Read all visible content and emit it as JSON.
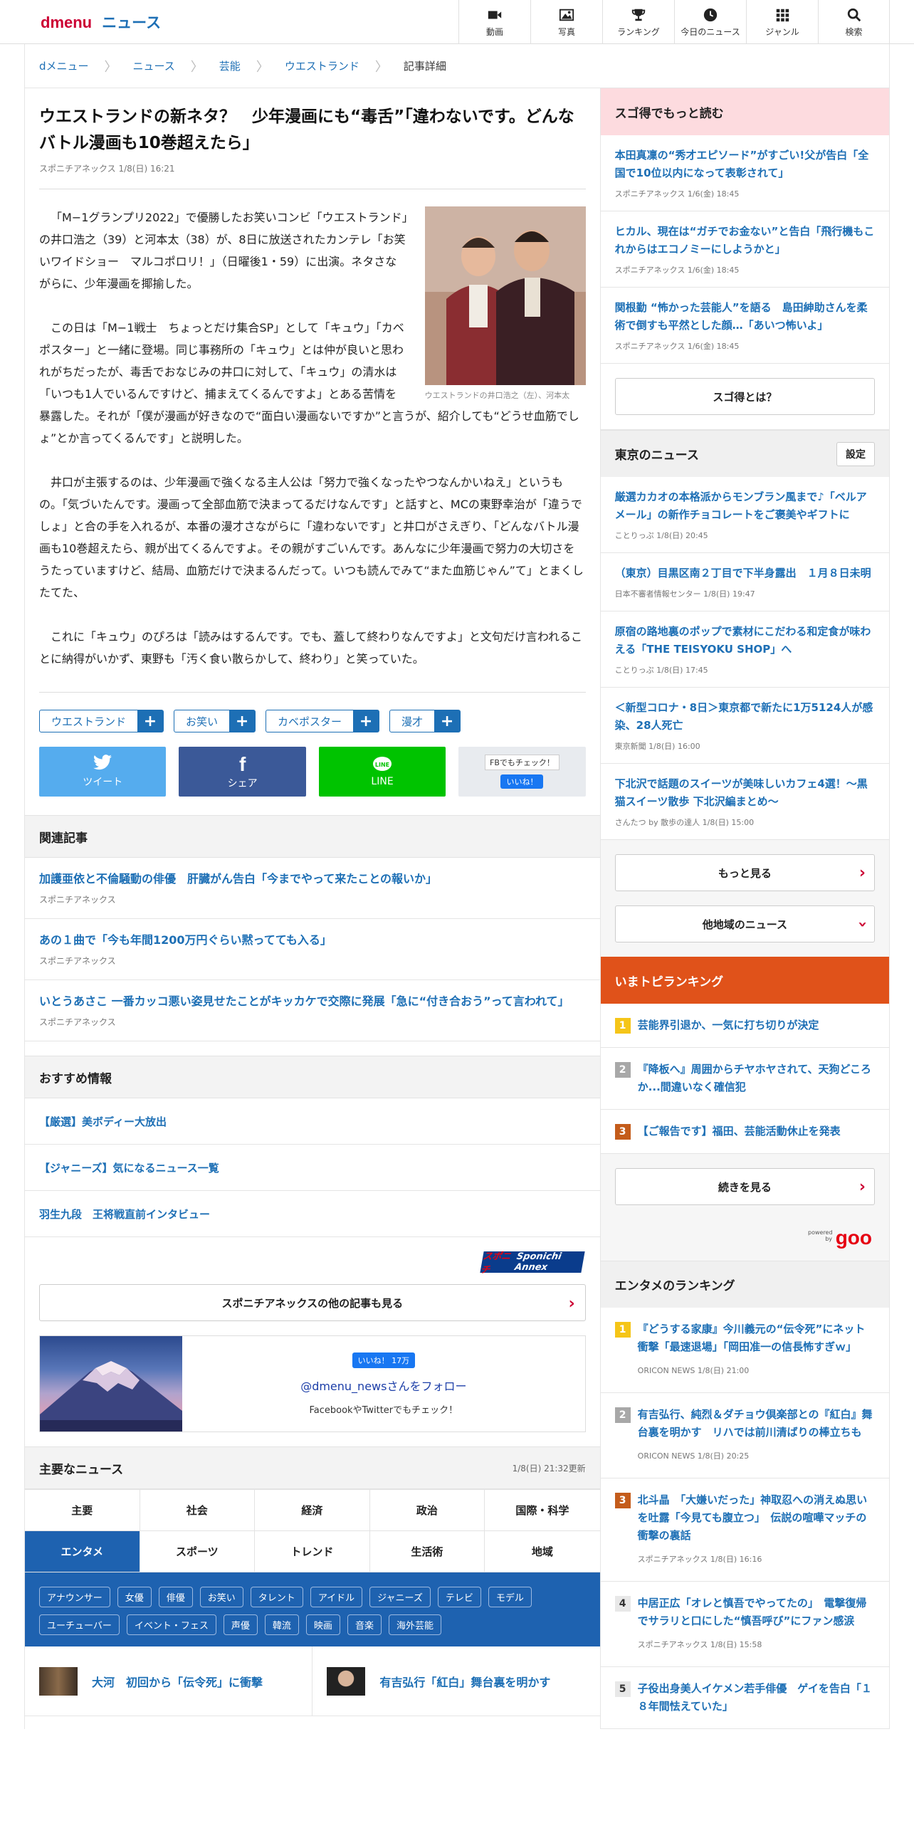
{
  "header": {
    "logo": "dmenu",
    "section": "ニュース",
    "nav": [
      {
        "label": "動画",
        "icon": "video-icon"
      },
      {
        "label": "写真",
        "icon": "photo-icon"
      },
      {
        "label": "ランキング",
        "icon": "trophy-icon"
      },
      {
        "label": "今日のニュース",
        "icon": "clock-icon"
      },
      {
        "label": "ジャンル",
        "icon": "grid-icon"
      },
      {
        "label": "検索",
        "icon": "search-icon"
      }
    ]
  },
  "breadcrumb": [
    "dメニュー",
    "ニュース",
    "芸能",
    "ウエストランド",
    "記事詳細"
  ],
  "article": {
    "title": "ウエストランドの新ネタ？　少年漫画にも“毒舌”「違わないです。どんなバトル漫画も10巻超えたら」",
    "meta": "スポニチアネックス 1/8(日) 16:21",
    "photo_caption": "ウエストランドの井口浩之（左）、河本太",
    "paragraphs": [
      "「M−1グランプリ2022」で優勝したお笑いコンビ「ウエストランド」の井口浩之（39）と河本太（38）が、8日に放送されたカンテレ「お笑いワイドショー　マルコポロリ！」（日曜後1・59）に出演。ネタさながらに、少年漫画を揶揄した。",
      "この日は「M−1戦士　ちょっとだけ集合SP」として「キュウ」「カベポスター」と一緒に登場。同じ事務所の「キュウ」とは仲が良いと思われがちだったが、毒舌でおなじみの井口に対して、「キュウ」の清水は「いつも1人でいるんですけど、捕まえてくるんですよ」とある苦情を暴露した。それが「僕が漫画が好きなので“面白い漫画ないですか”と言うが、紹介しても“どうせ血筋でしょ”とか言ってくるんです」と説明した。",
      "井口が主張するのは、少年漫画で強くなる主人公は「努力で強くなったやつなんかいねえ」というもの。「気づいたんです。漫画って全部血筋で決まってるだけなんです」と話すと、MCの東野幸治が「違うでしょ」と合の手を入れるが、本番の漫才さながらに「違わないです」と井口がさえぎり、「どんなバトル漫画も10巻超えたら、親が出てくるんですよ。その親がすごいんです。あんなに少年漫画で努力の大切さをうたっていますけど、結局、血筋だけで決まるんだって。いつも読んでみて“また血筋じゃん”て」とまくしたてた、",
      "これに「キュウ」のぴろは「読みはするんです。でも、蓋して終わりなんですよ」と文句だけ言われることに納得がいかず、東野も「汚く食い散らかして、終わり」と笑っていた。"
    ],
    "tags": [
      "ウエストランド",
      "お笑い",
      "カベポスター",
      "漫才"
    ],
    "share": {
      "tweet": "ツイート",
      "facebook": "シェア",
      "line": "LINE",
      "fb_check": "FBでもチェック！",
      "like": "いいね！"
    }
  },
  "related": {
    "heading": "関連記事",
    "items": [
      {
        "title": "加護亜依と不倫騒動の俳優　肝臓がん告白「今までやって来たことの報いか」",
        "source": "スポニチアネックス"
      },
      {
        "title": "あの１曲で「今も年間1200万円ぐらい黙ってても入る」",
        "source": "スポニチアネックス"
      },
      {
        "title": "いとうあさこ 一番カッコ悪い姿見せたことがキッカケで交際に発展「急に“付き合おう”って言われて」",
        "source": "スポニチアネックス"
      }
    ]
  },
  "recommend": {
    "heading": "おすすめ情報",
    "items": [
      "【厳選】美ボディー大放出",
      "【ジャニーズ】気になるニュース一覧",
      "羽生九段　王将戦直前インタビュー"
    ]
  },
  "sponichi": {
    "logo_a": "スポニチ",
    "logo_b": "Sponichi Annex",
    "more": "スポニチアネックスの他の記事も見る"
  },
  "follow": {
    "like": "いいね！ 17万",
    "handle": "@dmenu_newsさんをフォロー",
    "sub": "FacebookやTwitterでもチェック！"
  },
  "major": {
    "heading": "主要なニュース",
    "updated": "1/8(日) 21:32更新",
    "cats": [
      "主要",
      "社会",
      "経済",
      "政治",
      "国際・科学",
      "エンタメ",
      "スポーツ",
      "トレンド",
      "生活術",
      "地域"
    ],
    "subtags": [
      "アナウンサー",
      "女優",
      "俳優",
      "お笑い",
      "タレント",
      "アイドル",
      "ジャニーズ",
      "テレビ",
      "モデル",
      "ユーチューバー",
      "イベント・フェス",
      "声優",
      "韓流",
      "映画",
      "音楽",
      "海外芸能"
    ],
    "top": [
      "大河　初回から「伝令死」に衝撃",
      "有吉弘行「紅白」舞台裏を明かす"
    ]
  },
  "sidebar": {
    "sugotoku": {
      "heading": "スゴ得でもっと読む",
      "items": [
        {
          "title": "本田真凜の“秀才エピソード”がすごい!父が告白「全国で10位以内になって表彰されて」",
          "meta": "スポニチアネックス 1/6(金) 18:45"
        },
        {
          "title": "ヒカル、現在は“ガチでお金ない”と告白「飛行機もこれからはエコノミーにしようかと」",
          "meta": "スポニチアネックス 1/6(金) 18:45"
        },
        {
          "title": "関根勤 “怖かった芸能人”を語る　島田紳助さんを柔術で倒すも平然とした顔…「あいつ怖いよ」",
          "meta": "スポニチアネックス 1/6(金) 18:45"
        }
      ],
      "button": "スゴ得とは？"
    },
    "tokyo": {
      "heading": "東京のニュース",
      "setting": "設定",
      "items": [
        {
          "title": "厳選カカオの本格派からモンブラン風まで♪「ベルアメール」の新作チョコレートをご褒美やギフトに",
          "meta": "ことりっぷ 1/8(日) 20:45"
        },
        {
          "title": "（東京）目黒区南２丁目で下半身露出　１月８日未明",
          "meta": "日本不審者情報センター 1/8(日) 19:47"
        },
        {
          "title": "原宿の路地裏のポップで素材にこだわる和定食が味わえる「THE TEISYOKU SHOP」へ",
          "meta": "ことりっぷ 1/8(日) 17:45"
        },
        {
          "title": "＜新型コロナ・8日＞東京都で新たに1万5124人が感染、28人死亡",
          "meta": "東京新聞 1/8(日) 16:00"
        },
        {
          "title": "下北沢で話題のスイーツが美味しいカフェ4選！〜黒猫スイーツ散歩 下北沢編まとめ〜",
          "meta": "さんたつ by 散歩の達人 1/8(日) 15:00"
        }
      ],
      "more": "もっと見る",
      "other": "他地域のニュース"
    },
    "topics": {
      "heading": "いまトピランキング",
      "items": [
        {
          "n": "1",
          "title": "芸能界引退か、一気に打ち切りが決定"
        },
        {
          "n": "2",
          "title": "『降板へ』周囲からチヤホヤされて、天狗どころか...間違いなく確信犯"
        },
        {
          "n": "3",
          "title": "【ご報告です】福田、芸能活動休止を発表"
        }
      ],
      "more": "続きを見る",
      "powered": "powered by",
      "goo": "goo"
    },
    "enta": {
      "heading": "エンタメのランキング",
      "items": [
        {
          "n": "1",
          "title": "『どうする家康』今川義元の“伝令死”にネット衝撃「最速退場」「岡田准一の信長怖すぎｗ」",
          "meta": "ORICON NEWS 1/8(日) 21:00"
        },
        {
          "n": "2",
          "title": "有吉弘行、純烈＆ダチョウ倶楽部との『紅白』舞台裏を明かす　リハでは前川清ばりの棒立ちも",
          "meta": "ORICON NEWS 1/8(日) 20:25"
        },
        {
          "n": "3",
          "title": "北斗晶　「大嫌いだった」神取忍への消えぬ思いを吐露「今見ても腹立つ」　伝説の喧嘩マッチの衝撃の裏話",
          "meta": "スポニチアネックス 1/8(日) 16:16"
        },
        {
          "n": "4",
          "title": "中居正広「オレと慎吾でやってたの」　電撃復帰でサラリと口にした“慎吾呼び”にファン感涙",
          "meta": "スポニチアネックス 1/8(日) 15:58"
        },
        {
          "n": "5",
          "title": "子役出身美人イケメン若手俳優　ゲイを告白「１８年間怯えていた」",
          "meta": ""
        }
      ]
    }
  }
}
